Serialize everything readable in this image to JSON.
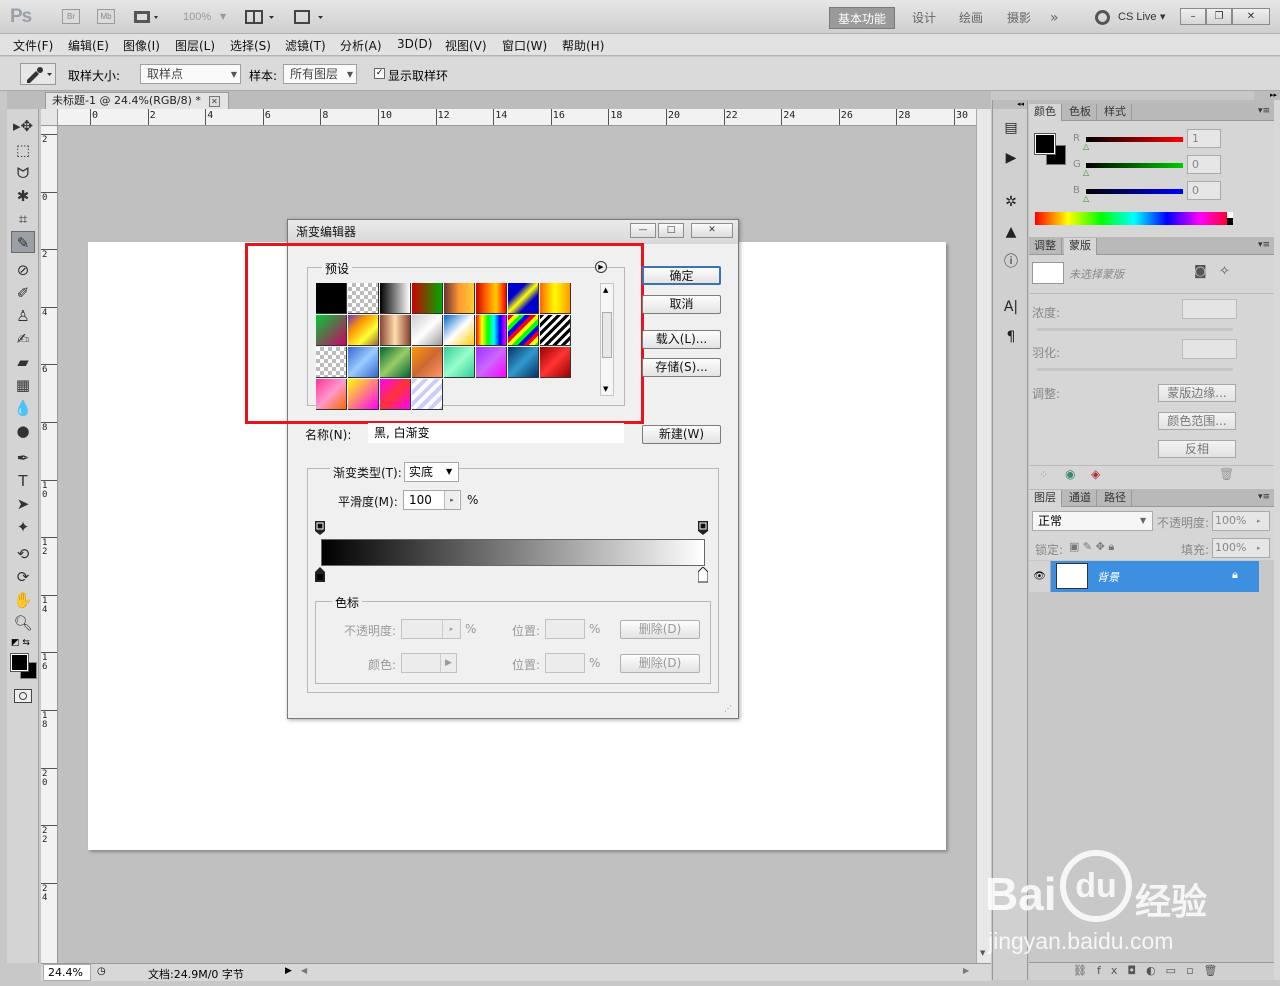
{
  "titlebar": {
    "app_logo": "Ps",
    "btn_br": "Br",
    "btn_mb": "Mb",
    "zoom": "100%",
    "workspaces": [
      "基本功能",
      "设计",
      "绘画",
      "摄影"
    ],
    "more": "»",
    "cslive": "CS Live",
    "win_min": "–",
    "win_max": "❐",
    "win_close": "✕"
  },
  "menubar": [
    "文件(F)",
    "编辑(E)",
    "图像(I)",
    "图层(L)",
    "选择(S)",
    "滤镜(T)",
    "分析(A)",
    "3D(D)",
    "视图(V)",
    "窗口(W)",
    "帮助(H)"
  ],
  "options": {
    "sample_size_label": "取样大小:",
    "sample_size_value": "取样点",
    "sample_label": "样本:",
    "sample_value": "所有图层",
    "show_ring_label": "显示取样环",
    "show_ring_checked": true
  },
  "document": {
    "tab_title": "未标题-1 @ 24.4%(RGB/8) *",
    "ruler_top": [
      "0",
      "2",
      "4",
      "6",
      "8",
      "10",
      "12",
      "14",
      "16",
      "18",
      "20",
      "22",
      "24",
      "26",
      "28",
      "30"
    ],
    "ruler_left": [
      "2",
      "0",
      "2",
      "4",
      "6",
      "8",
      "1 0",
      "1 2",
      "1 4",
      "1 6",
      "1 8",
      "2 0",
      "2 2",
      "2 4"
    ],
    "status_zoom": "24.4%",
    "status_doc": "文档:24.9M/0 字节"
  },
  "dialog": {
    "title": "渐变编辑器",
    "presets_label": "预设",
    "ok": "确定",
    "cancel": "取消",
    "load": "载入(L)...",
    "save": "存储(S)...",
    "name_label": "名称(N):",
    "name_value": "黑, 白渐变",
    "new": "新建(W)",
    "type_label": "渐变类型(T):",
    "type_value": "实底",
    "smooth_label": "平滑度(M):",
    "smooth_value": "100",
    "smooth_unit": "%",
    "stops_label": "色标",
    "opacity_label": "不透明度:",
    "opacity_unit": "%",
    "position_label": "位置:",
    "position_unit": "%",
    "delete": "删除(D)",
    "color_label": "颜色:",
    "highlight_color": "#e8141c"
  },
  "color_panel": {
    "tabs": [
      "颜色",
      "色板",
      "样式"
    ],
    "r_label": "R",
    "g_label": "G",
    "b_label": "B",
    "r_value": "1",
    "g_value": "0",
    "b_value": "0"
  },
  "masks_panel": {
    "tabs": [
      "调整",
      "蒙版"
    ],
    "no_mask": "未选择蒙版",
    "density": "浓度:",
    "feather": "羽化:",
    "refine": "调整:",
    "mask_edge": "蒙版边缘...",
    "color_range": "颜色范围...",
    "invert": "反相"
  },
  "layers_panel": {
    "tabs": [
      "图层",
      "通道",
      "路径"
    ],
    "blend_mode": "正常",
    "opacity_label": "不透明度:",
    "opacity_value": "100%",
    "lock_label": "锁定:",
    "fill_label": "填充:",
    "fill_value": "100%",
    "layer_name": "背景",
    "layer_bg": "#3d8fe0"
  },
  "watermark": {
    "brand": "Bai",
    "brand2": "经验",
    "url": "jingyan.baidu.com"
  }
}
